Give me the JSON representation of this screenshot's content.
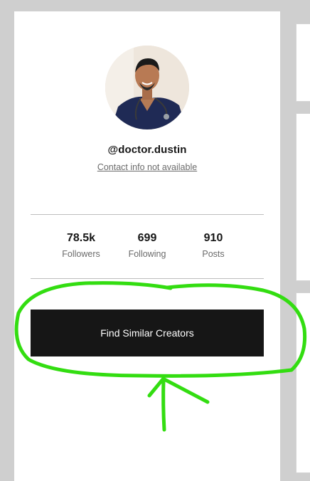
{
  "profile": {
    "handle": "@doctor.dustin",
    "contact_text": "Contact info not available"
  },
  "stats": [
    {
      "value": "78.5k",
      "label": "Followers"
    },
    {
      "value": "699",
      "label": "Following"
    },
    {
      "value": "910",
      "label": "Posts"
    }
  ],
  "actions": {
    "find_similar_label": "Find Similar Creators"
  },
  "colors": {
    "annotation": "#33dd11",
    "button_bg": "#161616",
    "page_bg": "#cfcfcf"
  }
}
